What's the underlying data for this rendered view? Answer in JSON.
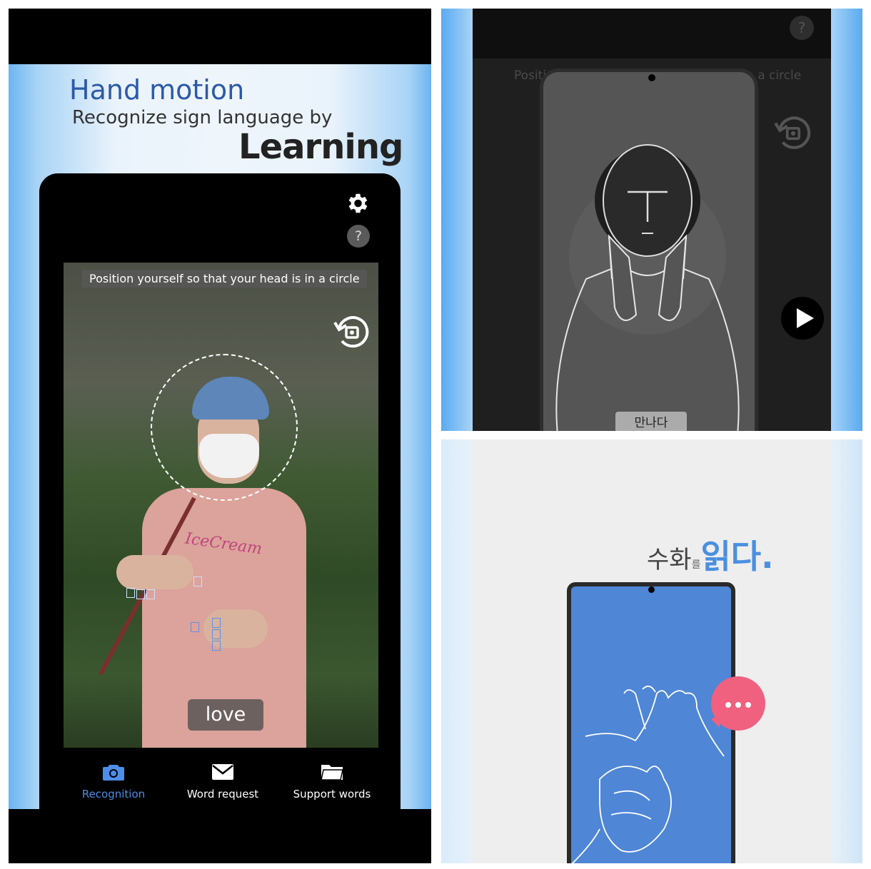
{
  "left": {
    "headline_title": "Hand motion",
    "headline_sub": "Recognize sign language by",
    "headline_big": "Learning",
    "hint": "Position yourself so that your head is in a circle",
    "recognized_word": "love",
    "shirt_logo": "IceCream",
    "help": "?",
    "nav": [
      {
        "label": "Recognition",
        "icon": "camera-icon",
        "active": true
      },
      {
        "label": "Word request",
        "icon": "mail-icon",
        "active": false
      },
      {
        "label": "Support words",
        "icon": "folder-icon",
        "active": false
      }
    ],
    "colors": {
      "accent": "#4d8de8",
      "title": "#2c5aa6"
    }
  },
  "top_right": {
    "help": "?",
    "hint": "Position yourself so that your head is in a circle",
    "sign_word": "만나다"
  },
  "bottom_right": {
    "text_a": "수화",
    "text_b": "를",
    "text_c": "읽다.",
    "bubble_icon": "chat-bubble-icon",
    "colors": {
      "phone": "#4f86d6",
      "bubble": "#f0607f"
    }
  }
}
